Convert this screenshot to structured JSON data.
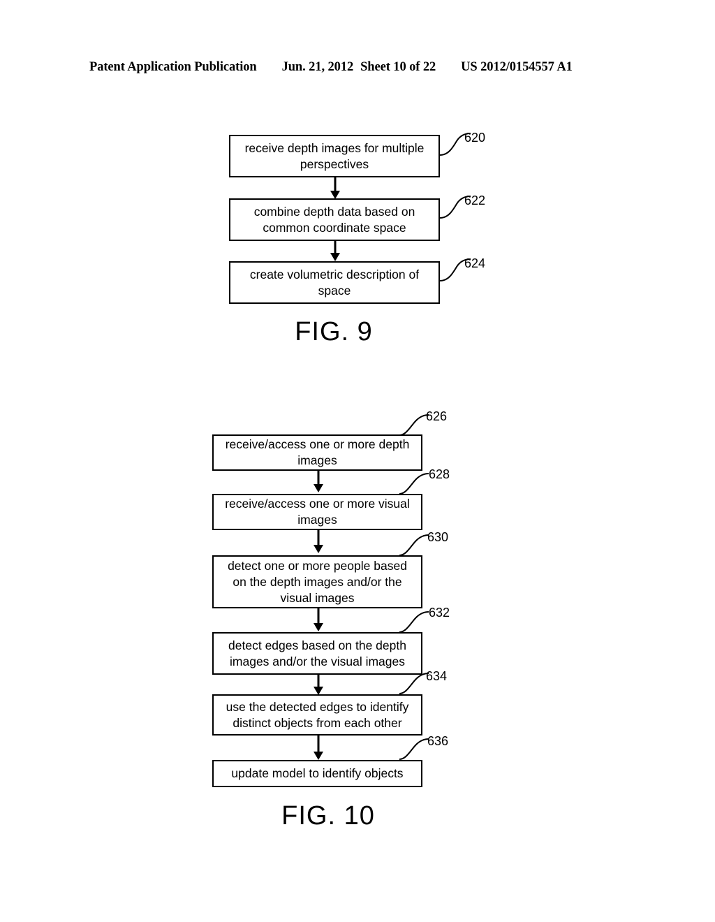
{
  "header": {
    "publication": "Patent Application Publication",
    "date": "Jun. 21, 2012",
    "sheet": "Sheet 10 of 22",
    "patent_number": "US 2012/0154557 A1"
  },
  "figures": [
    {
      "id": "fig9",
      "label": "FIG. 9",
      "steps": [
        {
          "ref": "620",
          "text": "receive depth images for multiple perspectives"
        },
        {
          "ref": "622",
          "text": "combine depth data based on common coordinate space"
        },
        {
          "ref": "624",
          "text": "create volumetric description of space"
        }
      ]
    },
    {
      "id": "fig10",
      "label": "FIG. 10",
      "steps": [
        {
          "ref": "626",
          "text": "receive/access one or more depth images"
        },
        {
          "ref": "628",
          "text": "receive/access one or more visual images"
        },
        {
          "ref": "630",
          "text": "detect one or more people based on the depth images and/or the visual images"
        },
        {
          "ref": "632",
          "text": "detect edges based on the depth images and/or the visual images"
        },
        {
          "ref": "634",
          "text": "use the detected edges to identify distinct objects from each other"
        },
        {
          "ref": "636",
          "text": "update model to identify objects"
        }
      ]
    }
  ],
  "colors": {
    "ink": "#000000",
    "paper": "#ffffff"
  }
}
